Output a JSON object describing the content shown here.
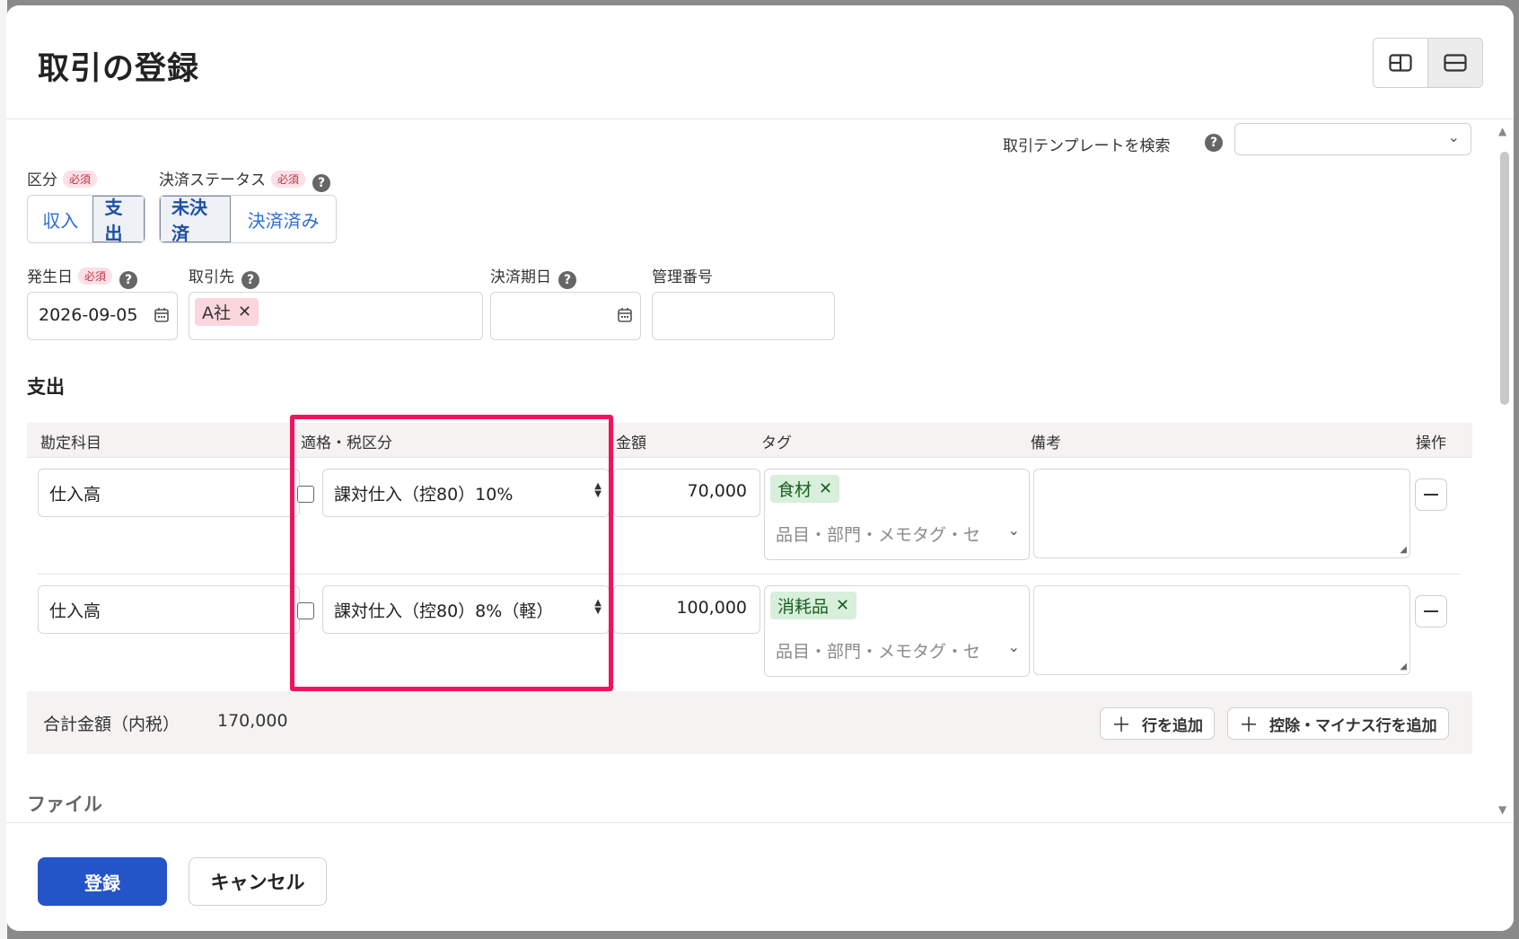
{
  "modal": {
    "title": "取引の登録"
  },
  "template_search": {
    "label": "取引テンプレートを検索",
    "value": ""
  },
  "required_badge": "必須",
  "fields": {
    "kubun": {
      "label": "区分",
      "options": [
        "収入",
        "支出"
      ],
      "selected": "支出"
    },
    "payment_status": {
      "label": "決済ステータス",
      "options": [
        "未決済",
        "決済済み"
      ],
      "selected": "未決済"
    },
    "issue_date": {
      "label": "発生日",
      "value": "2026-09-05"
    },
    "partner": {
      "label": "取引先",
      "chip": "A社"
    },
    "due_date": {
      "label": "決済期日",
      "value": ""
    },
    "control_number": {
      "label": "管理番号",
      "value": ""
    }
  },
  "section": {
    "title": "支出"
  },
  "table": {
    "headers": [
      "勘定科目",
      "適格・税区分",
      "金額",
      "タグ",
      "備考",
      "操作"
    ],
    "tag_placeholder": "品目・部門・メモタグ・セ",
    "rows": [
      {
        "account": "仕入高",
        "qualified": false,
        "tax": "課対仕入（控80）10%",
        "amount": "70,000",
        "tag": "食材",
        "note": ""
      },
      {
        "account": "仕入高",
        "qualified": false,
        "tax": "課対仕入（控80）8%（軽）",
        "amount": "100,000",
        "tag": "消耗品",
        "note": ""
      }
    ]
  },
  "total": {
    "label": "合計金額（内税）",
    "value": "170,000"
  },
  "actions": {
    "add_row": "行を追加",
    "add_deduction_row": "控除・マイナス行を追加"
  },
  "files": {
    "title": "ファイル"
  },
  "footer": {
    "submit": "登録",
    "cancel": "キャンセル"
  },
  "colors": {
    "primary": "#2355c9",
    "highlight": "#f0145a",
    "tag_green": "#d7efdb",
    "chip_pink": "#fbd7dd"
  }
}
